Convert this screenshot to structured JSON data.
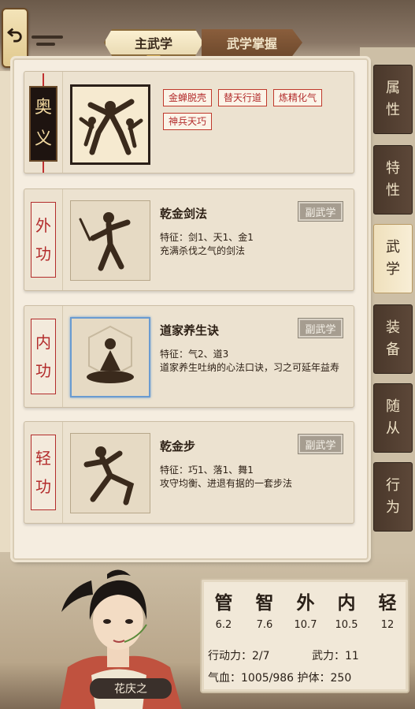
{
  "tabs": {
    "main": "主武学",
    "mastery": "武学掌握"
  },
  "aoyi": {
    "label_chars": [
      "奥",
      "义"
    ],
    "tags": [
      "金蝉脱壳",
      "替天行道",
      "炼精化气",
      "神兵天巧"
    ]
  },
  "skills": [
    {
      "category_chars": [
        "外",
        "功"
      ],
      "name": "乾金剑法",
      "badge": "副武学",
      "feature": "特征：剑1、天1、金1",
      "desc": "充满杀伐之气的剑法"
    },
    {
      "category_chars": [
        "内",
        "功"
      ],
      "name": "道家养生诀",
      "badge": "副武学",
      "feature": "特征：气2、道3",
      "desc": "道家养生吐纳的心法口诀，习之可延年益寿"
    },
    {
      "category_chars": [
        "轻",
        "功"
      ],
      "name": "乾金步",
      "badge": "副武学",
      "feature": "特征：巧1、落1、舞1",
      "desc": "攻守均衡、进退有据的一套步法"
    }
  ],
  "nav": [
    {
      "chars": [
        "属",
        "性"
      ]
    },
    {
      "chars": [
        "特",
        "性"
      ]
    },
    {
      "chars": [
        "武",
        "学"
      ]
    },
    {
      "chars": [
        "装",
        "备"
      ]
    },
    {
      "chars": [
        "随",
        "从"
      ]
    },
    {
      "chars": [
        "行",
        "为"
      ]
    }
  ],
  "character": {
    "name": "花庆之"
  },
  "stats": {
    "attrs": [
      {
        "label": "管",
        "value": "6.2"
      },
      {
        "label": "智",
        "value": "7.6"
      },
      {
        "label": "外",
        "value": "10.7"
      },
      {
        "label": "内",
        "value": "10.5"
      },
      {
        "label": "轻",
        "value": "12"
      }
    ],
    "action": "行动力：2/7",
    "force": "武力：11",
    "hp_armor": "气血：1005/986 护体：250"
  },
  "colors": {
    "accent_red": "#b32c2c",
    "nav_dark": "#4a382b",
    "selected_blue": "#6a9bd1"
  }
}
